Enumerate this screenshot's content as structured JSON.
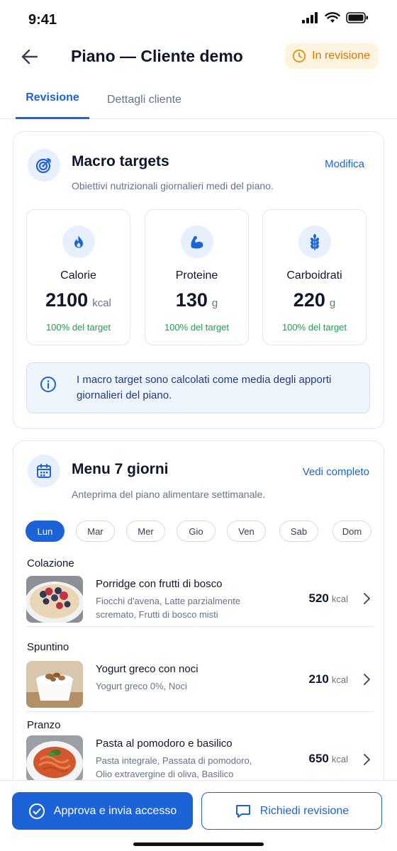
{
  "status_bar": {
    "time": "9:41"
  },
  "header": {
    "title": "Piano — Cliente demo",
    "status_badge": "In revisione",
    "status_color": "#d97706"
  },
  "tabs": [
    {
      "label": "Revisione",
      "active": true
    },
    {
      "label": "Dettagli cliente",
      "active": false
    }
  ],
  "macro_card": {
    "title": "Macro targets",
    "action": "Modifica",
    "subtitle": "Obiettivi nutrizionali giornalieri medi del piano.",
    "items": [
      {
        "name": "Calorie",
        "value": "2100",
        "unit": "kcal",
        "target": "100% del target",
        "icon": "flame-icon"
      },
      {
        "name": "Proteine",
        "value": "130",
        "unit": "g",
        "target": "100% del target",
        "icon": "muscle-icon"
      },
      {
        "name": "Carboidrati",
        "value": "220",
        "unit": "g",
        "target": "100% del target",
        "icon": "wheat-icon"
      }
    ],
    "info": "I macro target sono calcolati come media degli apporti giornalieri del piano."
  },
  "menu_card": {
    "title": "Menu 7 giorni",
    "action": "Vedi completo",
    "subtitle": "Anteprima del piano alimentare settimanale.",
    "days": [
      "Lun",
      "Mar",
      "Mer",
      "Gio",
      "Ven",
      "Sab",
      "Dom"
    ],
    "active_day": "Lun",
    "meals": [
      {
        "section": "Colazione",
        "name": "Porridge con frutti di bosco",
        "description": "Fiocchi d'avena, Latte parzialmente scremato, Frutti di bosco misti",
        "kcal": "520",
        "unit": "kcal"
      },
      {
        "section": "Spuntino",
        "name": "Yogurt greco con noci",
        "description": "Yogurt greco 0%, Noci",
        "kcal": "210",
        "unit": "kcal"
      },
      {
        "section": "Pranzo",
        "name": "Pasta al pomodoro e basilico",
        "description": "Pasta integrale, Passata di pomodoro, Olio extravergine di oliva, Basilico",
        "kcal": "650",
        "unit": "kcal"
      }
    ]
  },
  "actions": {
    "approve": "Approva e invia accesso",
    "request_revision": "Richiedi revisione"
  },
  "colors": {
    "accent": "#1d63d8",
    "success": "#16a34a",
    "warning": "#d97706"
  }
}
